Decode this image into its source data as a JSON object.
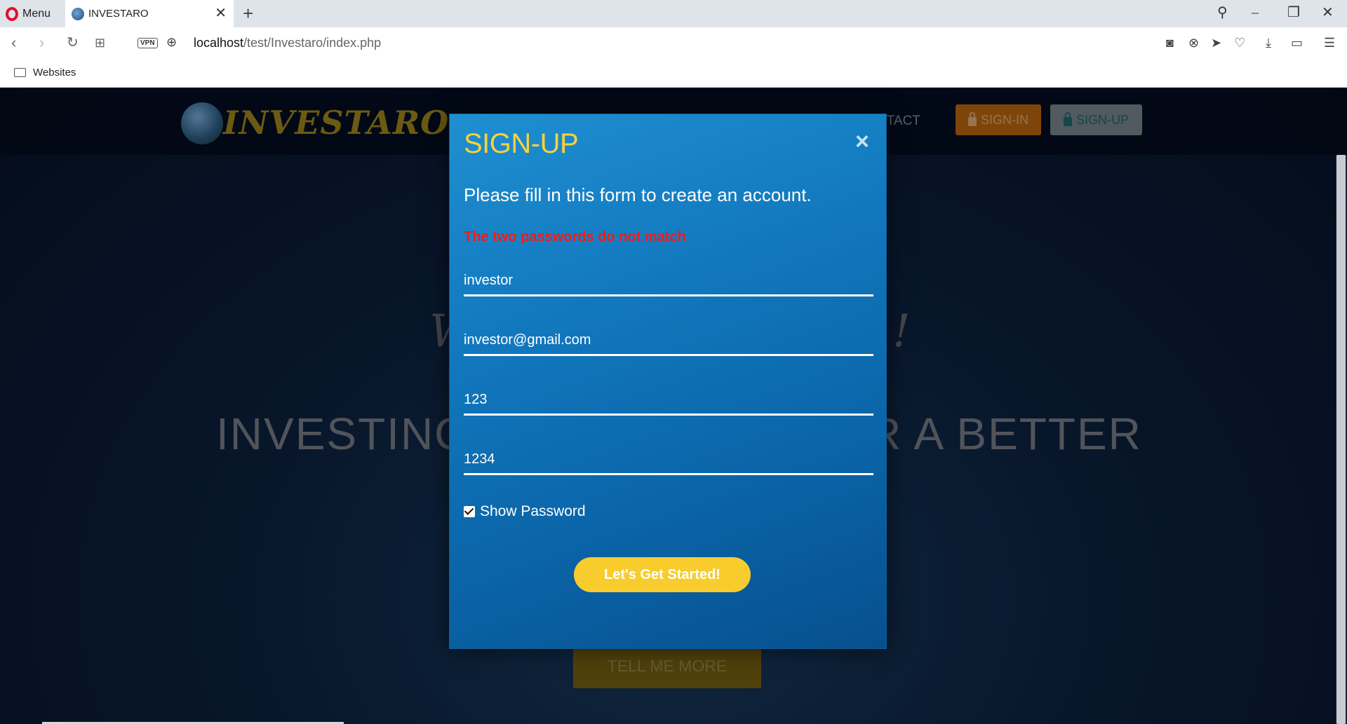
{
  "browser": {
    "menu_label": "Menu",
    "tab_title": "INVESTARO",
    "url_host": "localhost",
    "url_path": "/test/Investaro/index.php",
    "vpn_label": "VPN",
    "bookmark_folder": "Websites"
  },
  "site": {
    "logo_text": "INVESTARO",
    "nav_contact": "NTACT",
    "signin_label": "SIGN-IN",
    "signup_label": "SIGN-UP",
    "hero_w": "W",
    "hero_bang": "!",
    "hero_left": "INVESTINC",
    "hero_right": "R A BETTER",
    "cta_label": "TELL ME MORE"
  },
  "modal": {
    "title": "SIGN-UP",
    "close_glyph": "×",
    "subtitle": "Please fill in this form to create an account.",
    "error": "The two passwords do not match",
    "username_value": "investor",
    "email_value": "investor@gmail.com",
    "password_value": "123",
    "confirm_value": "1234",
    "show_password_label": "Show Password",
    "show_password_checked": true,
    "submit_label": "Let's Get Started!"
  },
  "colors": {
    "modal_blue": "#1278be",
    "title_yellow": "#f6d23a",
    "error_red": "#ee1c1c",
    "button_yellow": "#f8cc2c",
    "signin_orange": "#c26b10"
  }
}
